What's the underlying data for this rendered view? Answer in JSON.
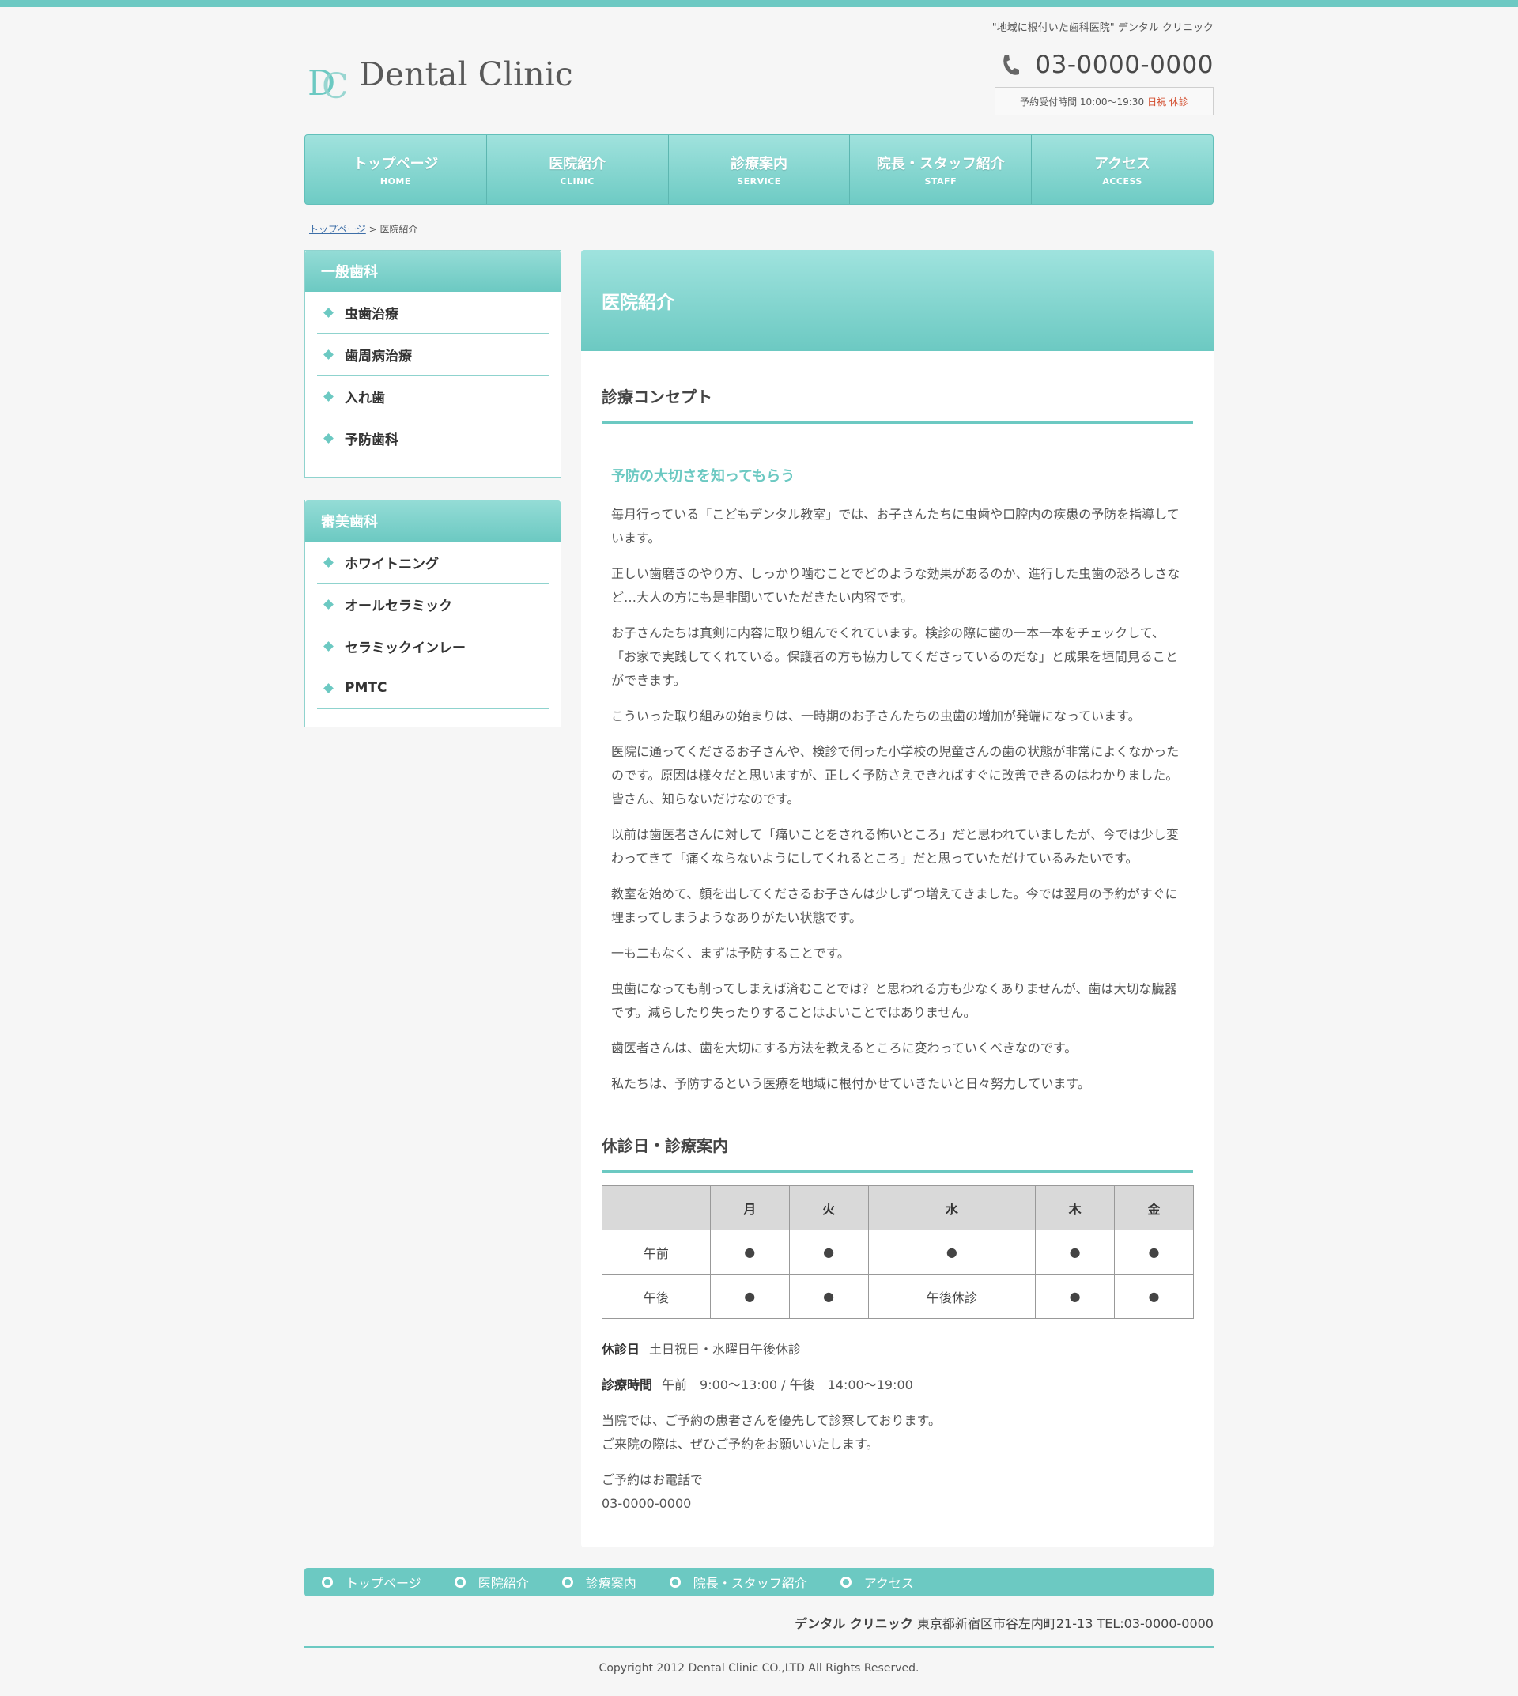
{
  "header": {
    "tagline": "\"地域に根付いた歯科医院\" デンタル クリニック",
    "logo_text": "Dental Clinic",
    "logo_mark": "DC",
    "phone": "03-0000-0000",
    "hours_text": "予約受付時間 10:00〜19:30",
    "hours_closed": "日祝 休診"
  },
  "nav": [
    {
      "jp": "トップページ",
      "en": "HOME"
    },
    {
      "jp": "医院紹介",
      "en": "CLINIC"
    },
    {
      "jp": "診療案内",
      "en": "SERVICE"
    },
    {
      "jp": "院長・スタッフ紹介",
      "en": "STAFF"
    },
    {
      "jp": "アクセス",
      "en": "ACCESS"
    }
  ],
  "breadcrumb": {
    "home": "トップページ",
    "sep": " > ",
    "current": "医院紹介"
  },
  "sidebar": [
    {
      "title": "一般歯科",
      "items": [
        "虫歯治療",
        "歯周病治療",
        "入れ歯",
        "予防歯科"
      ]
    },
    {
      "title": "審美歯科",
      "items": [
        "ホワイトニング",
        "オールセラミック",
        "セラミックインレー",
        "PMTC"
      ]
    }
  ],
  "main": {
    "page_title": "医院紹介",
    "section1_title": "診療コンセプト",
    "section1_subtitle": "予防の大切さを知ってもらう",
    "paragraphs": [
      "毎月行っている「こどもデンタル教室」では、お子さんたちに虫歯や口腔内の疾患の予防を指導しています。",
      "正しい歯磨きのやり方、しっかり噛むことでどのような効果があるのか、進行した虫歯の恐ろしさなど…大人の方にも是非聞いていただきたい内容です。",
      "お子さんたちは真剣に内容に取り組んでくれています。検診の際に歯の一本一本をチェックして、「お家で実践してくれている。保護者の方も協力してくださっているのだな」と成果を垣間見ることができます。",
      "こういった取り組みの始まりは、一時期のお子さんたちの虫歯の増加が発端になっています。",
      "医院に通ってくださるお子さんや、検診で伺った小学校の児童さんの歯の状態が非常によくなかったのです。原因は様々だと思いますが、正しく予防さえできればすぐに改善できるのはわかりました。皆さん、知らないだけなのです。",
      "以前は歯医者さんに対して「痛いことをされる怖いところ」だと思われていましたが、今では少し変わってきて「痛くならないようにしてくれるところ」だと思っていただけているみたいです。",
      "教室を始めて、顔を出してくださるお子さんは少しずつ増えてきました。今では翌月の予約がすぐに埋まってしまうようなありがたい状態です。",
      "一も二もなく、まずは予防することです。",
      "虫歯になっても削ってしまえば済むことでは？と思われる方も少なくありませんが、歯は大切な臓器です。減らしたり失ったりすることはよいことではありません。",
      "歯医者さんは、歯を大切にする方法を教えるところに変わっていくべきなのです。",
      "私たちは、予防するという医療を地域に根付かせていきたいと日々努力しています。"
    ],
    "section2_title": "休診日・診療案内",
    "schedule": {
      "headers": [
        "",
        "月",
        "火",
        "水",
        "木",
        "金"
      ],
      "rows": [
        [
          "午前",
          "●",
          "●",
          "●",
          "●",
          "●"
        ],
        [
          "午後",
          "●",
          "●",
          "午後休診",
          "●",
          "●"
        ]
      ]
    },
    "closed_label": "休診日",
    "closed_value": "土日祝日・水曜日午後休診",
    "hours_label": "診療時間",
    "hours_value": "午前　9:00〜13:00 / 午後　14:00〜19:00",
    "note_line1": "当院では、ご予約の患者さんを優先して診察しております。",
    "note_line2": "ご来院の際は、ぜひご予約をお願いいたします。",
    "reserve_line1": "ご予約はお電話で",
    "reserve_line2": "03-0000-0000"
  },
  "footer": {
    "links": [
      "トップページ",
      "医院紹介",
      "診療案内",
      "院長・スタッフ紹介",
      "アクセス"
    ],
    "clinic_name": "デンタル クリニック",
    "address": "東京都新宿区市谷左内町21-13 TEL:03-0000-0000",
    "copyright": "Copyright 2012 Dental Clinic CO.,LTD All Rights Reserved."
  },
  "colors": {
    "accent": "#6cc9c2",
    "closed_red": "#d24a2a",
    "background": "#f6f6f6"
  }
}
